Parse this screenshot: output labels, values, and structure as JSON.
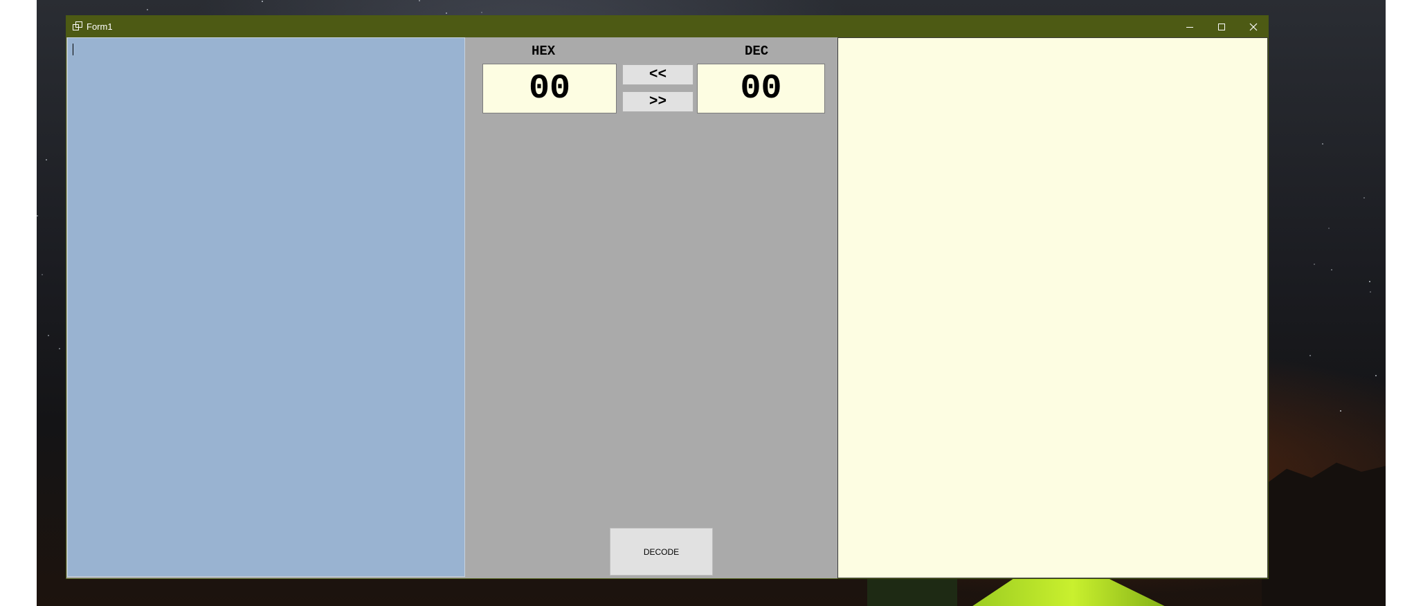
{
  "window": {
    "title": "Form1",
    "controls": {
      "minimize_icon": "minimize-icon",
      "maximize_icon": "maximize-icon",
      "close_icon": "close-icon"
    }
  },
  "input": {
    "value": ""
  },
  "converter": {
    "hex_label": "HEX",
    "dec_label": "DEC",
    "hex_value": "00",
    "dec_value": "00",
    "to_hex_label": "<<",
    "to_dec_label": ">>"
  },
  "actions": {
    "decode_label": "DECODE"
  },
  "output": {
    "value": ""
  },
  "colors": {
    "titlebar": "#4d5a14",
    "input_bg": "#99b3d1",
    "panel_bg": "#aaaaaa",
    "output_bg": "#fdfde2"
  }
}
